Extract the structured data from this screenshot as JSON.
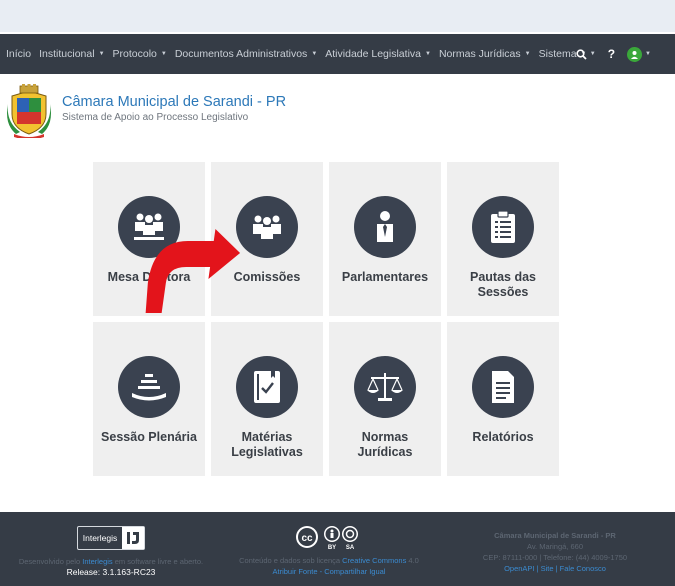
{
  "nav": {
    "items": [
      {
        "label": "Início",
        "caret": false
      },
      {
        "label": "Institucional",
        "caret": true
      },
      {
        "label": "Protocolo",
        "caret": true
      },
      {
        "label": "Documentos Administrativos",
        "caret": true
      },
      {
        "label": "Atividade Legislativa",
        "caret": true
      },
      {
        "label": "Normas Jurídicas",
        "caret": true
      },
      {
        "label": "Sistema",
        "caret": true
      }
    ],
    "search_icon": "search-icon",
    "help_label": "?",
    "user_icon": "user-icon"
  },
  "brand": {
    "title": "Câmara Municipal de Sarandi - PR",
    "subtitle": "Sistema de Apoio ao Processo Legislativo"
  },
  "tiles": [
    {
      "label": "Mesa Diretora",
      "icon": "group-icon"
    },
    {
      "label": "Comissões",
      "icon": "group-icon"
    },
    {
      "label": "Parlamentares",
      "icon": "person-icon"
    },
    {
      "label": "Pautas das Sessões",
      "icon": "clipboard-icon"
    },
    {
      "label": "Sessão Plenária",
      "icon": "plenary-icon"
    },
    {
      "label": "Matérias Legislativas",
      "icon": "book-icon"
    },
    {
      "label": "Normas Jurídicas",
      "icon": "scales-icon"
    },
    {
      "label": "Relatórios",
      "icon": "document-icon"
    }
  ],
  "footer": {
    "logo_text": "Interlegis",
    "dev_prefix": "Desenvolvido pelo",
    "dev_link": "Interlegis",
    "dev_suffix": "em software livre e aberto.",
    "release": "Release: 3.1.163-RC23",
    "license_prefix": "Conteúdo e dados sob licença",
    "license_link": "Creative Commons",
    "license_version": "4.0",
    "license_sub": "Atribuir Fonte - Compartilhar Igual",
    "org_name": "Câmara Municipal de Sarandi - PR",
    "address": "Av. Maringá, 660",
    "contact": "CEP: 87111-000 | Telefone: (44) 4009-1750",
    "links": "OpenAPI | Site | Fale Conosco"
  },
  "colors": {
    "navbar": "#353c46",
    "brand_blue": "#2c78b8",
    "tile_bg": "#efefef",
    "icon_circle": "#3a4250",
    "arrow_red": "#e3141b"
  }
}
